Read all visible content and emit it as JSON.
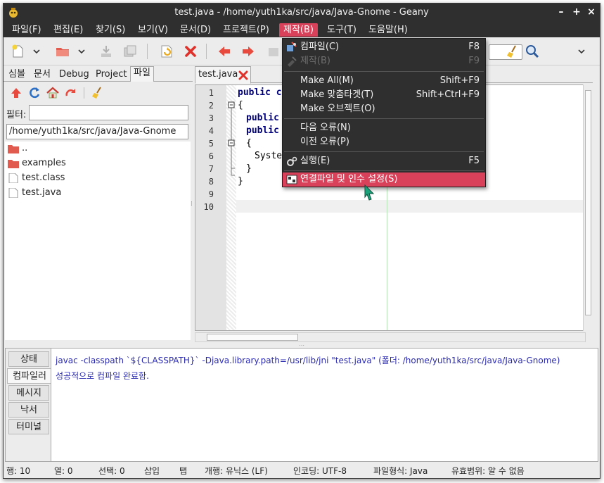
{
  "window": {
    "title": "test.java - /home/yuth1ka/src/java/Java-Gnome - Geany",
    "controls": {
      "minimize": "–",
      "maximize": "+",
      "close": "×"
    }
  },
  "menubar": {
    "items": [
      "파일(F)",
      "편집(E)",
      "찾기(S)",
      "보기(V)",
      "문서(D)",
      "프로젝트(P)",
      "제작(B)",
      "도구(T)",
      "도움말(H)"
    ],
    "active": "제작(B)"
  },
  "build_menu": {
    "items": [
      {
        "label": "컴파일(C)",
        "accel": "F8",
        "icon": "compile-icon",
        "disabled": false
      },
      {
        "label": "제작(B)",
        "accel": "F9",
        "icon": "build-icon",
        "disabled": true
      },
      {
        "label": "Make All(M)",
        "accel": "Shift+F9",
        "disabled": false
      },
      {
        "label": "Make 맞춤타겟(T)",
        "accel": "Shift+Ctrl+F9",
        "disabled": false
      },
      {
        "label": "Make 오브젝트(O)",
        "accel": "",
        "disabled": false
      },
      {
        "label": "다음 오류(N)",
        "accel": "",
        "disabled": false
      },
      {
        "label": "이전 오류(P)",
        "accel": "",
        "disabled": false
      },
      {
        "label": "실행(E)",
        "accel": "F5",
        "icon": "execute-icon",
        "disabled": false
      },
      {
        "label": "연결파일 및 인수 설정(S)",
        "accel": "",
        "icon": "settings-icon",
        "disabled": false,
        "highlighted": true
      }
    ]
  },
  "sidebar": {
    "tabs": [
      "심볼",
      "문서",
      "Debug",
      "Project",
      "파일"
    ],
    "active_tab": "파일",
    "filter_label": "필터:",
    "filter_value": "",
    "path": "/home/yuth1ka/src/java/Java-Gnome",
    "files": [
      {
        "name": "..",
        "type": "folder"
      },
      {
        "name": "examples",
        "type": "folder"
      },
      {
        "name": "test.class",
        "type": "file"
      },
      {
        "name": "test.java",
        "type": "file"
      }
    ]
  },
  "editor": {
    "tab_label": "test.java",
    "line_numbers": [
      "1",
      "2",
      "3",
      "4",
      "5",
      "6",
      "7",
      "8",
      "9",
      "10"
    ],
    "lines": [
      {
        "kw": "public",
        "rest": " c"
      },
      {
        "kw": "",
        "rest": "{"
      },
      {
        "kw": "public",
        "rest": ""
      },
      {
        "kw": "public",
        "rest": ""
      },
      {
        "kw": "",
        "rest": "{"
      },
      {
        "kw": "",
        "rest": "Syste"
      },
      {
        "kw": "",
        "rest": "}"
      },
      {
        "kw": "",
        "rest": "}"
      },
      {
        "kw": "",
        "rest": ""
      },
      {
        "kw": "",
        "rest": ""
      }
    ]
  },
  "bottom_panel": {
    "tabs": [
      "상태",
      "컴파일러",
      "메시지",
      "낙서",
      "터미널"
    ],
    "active_tab": "컴파일러",
    "messages": [
      "javac -classpath `${CLASSPATH}` -Djava.library.path=/usr/lib/jni \"test.java\" (폴더: /home/yuth1ka/src/java/Java-Gnome)",
      "성공적으로 컴파일 완료함."
    ]
  },
  "statusbar": {
    "line": "행: 10",
    "col": "열: 0",
    "sel": "선택: 0",
    "mode": "삽입",
    "indent": "탭",
    "eol": "개행: 유닉스 (LF)",
    "encoding": "인코딩: UTF-8",
    "filetype": "파일형식: Java",
    "scope": "유효범위: 알 수 없음"
  },
  "colors": {
    "accent": "#d9405a",
    "dark_bg": "#2f2f2f",
    "keyword": "#00007f",
    "message": "#2a2ab0"
  }
}
